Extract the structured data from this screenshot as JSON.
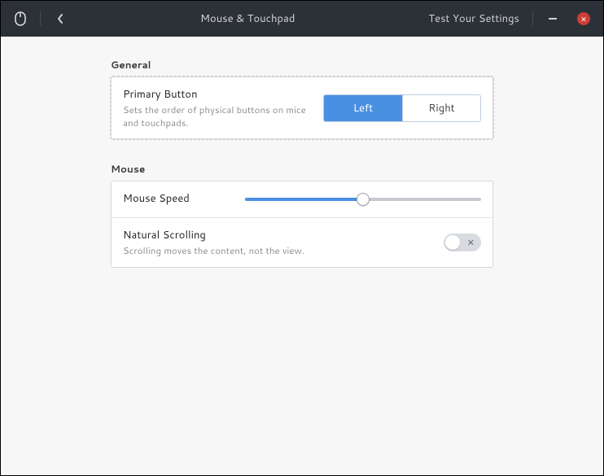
{
  "header": {
    "title": "Mouse & Touchpad",
    "test_label": "Test Your Settings"
  },
  "general": {
    "heading": "General",
    "primary_button": {
      "title": "Primary Button",
      "description": "Sets the order of physical buttons on mice and touchpads.",
      "left_label": "Left",
      "right_label": "Right",
      "selected": "left"
    }
  },
  "mouse": {
    "heading": "Mouse",
    "speed": {
      "title": "Mouse Speed",
      "value_percent": 50
    },
    "natural_scrolling": {
      "title": "Natural Scrolling",
      "description": "Scrolling moves the content, not the view.",
      "enabled": false
    }
  }
}
